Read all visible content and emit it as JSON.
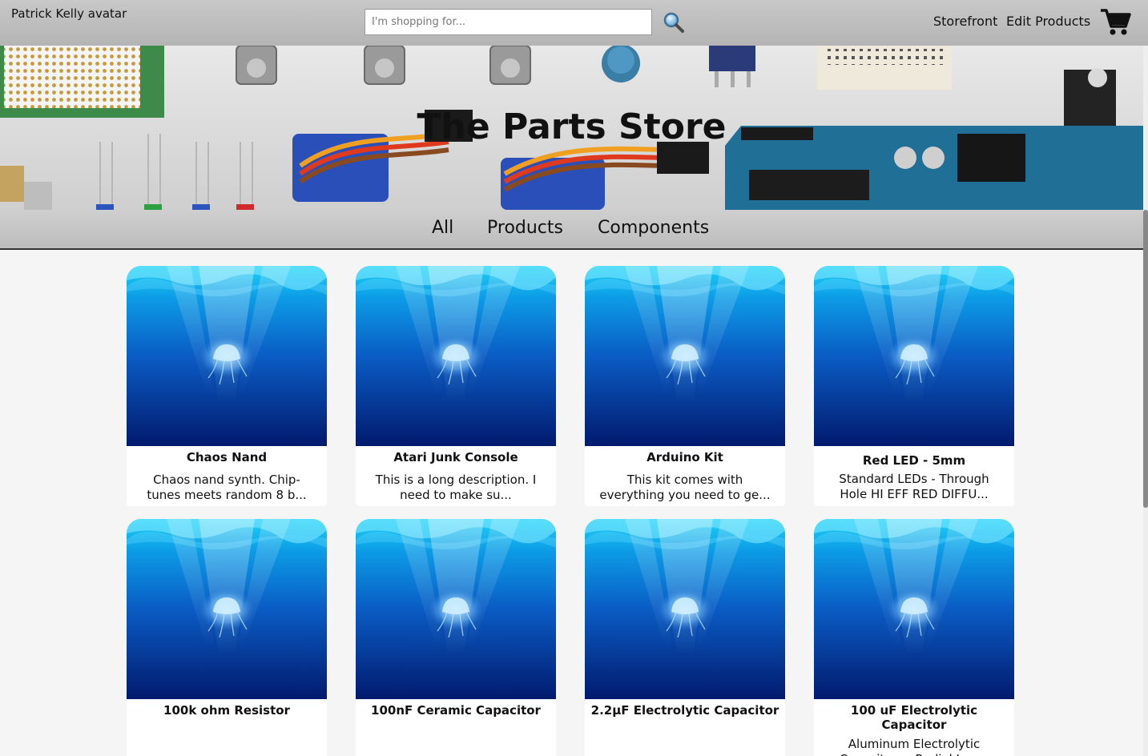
{
  "header": {
    "avatar_alt": "Patrick Kelly avatar",
    "search_placeholder": "I'm shopping for...",
    "nav": {
      "storefront": "Storefront",
      "edit_products": "Edit Products"
    }
  },
  "hero": {
    "title": "The Parts Store"
  },
  "categories": [
    "All",
    "Products",
    "Components"
  ],
  "products": [
    {
      "name": "Chaos Nand",
      "desc": "Chaos nand synth. Chip-tunes meets random 8 b..."
    },
    {
      "name": "Atari Junk Console",
      "desc": "This is a long description. I need to make su..."
    },
    {
      "name": "Arduino Kit",
      "desc": "This kit comes with everything you need to ge..."
    },
    {
      "name": "Red LED - 5mm",
      "desc": "Standard LEDs - Through Hole HI EFF RED DIFFU..."
    },
    {
      "name": "100k ohm Resistor",
      "desc": ""
    },
    {
      "name": "100nF Ceramic Capacitor",
      "desc": ""
    },
    {
      "name": "2.2µF Electrolytic Capacitor",
      "desc": ""
    },
    {
      "name": "100 uF Electrolytic Capacitor",
      "desc": "Aluminum Electrolytic Capacitors - Radial Lea..."
    }
  ],
  "colors": {
    "ocean_top": "#19c6f0",
    "ocean_mid": "#0a63c6",
    "ocean_bottom": "#021a6e",
    "header_bg": "#c0c0c0"
  }
}
